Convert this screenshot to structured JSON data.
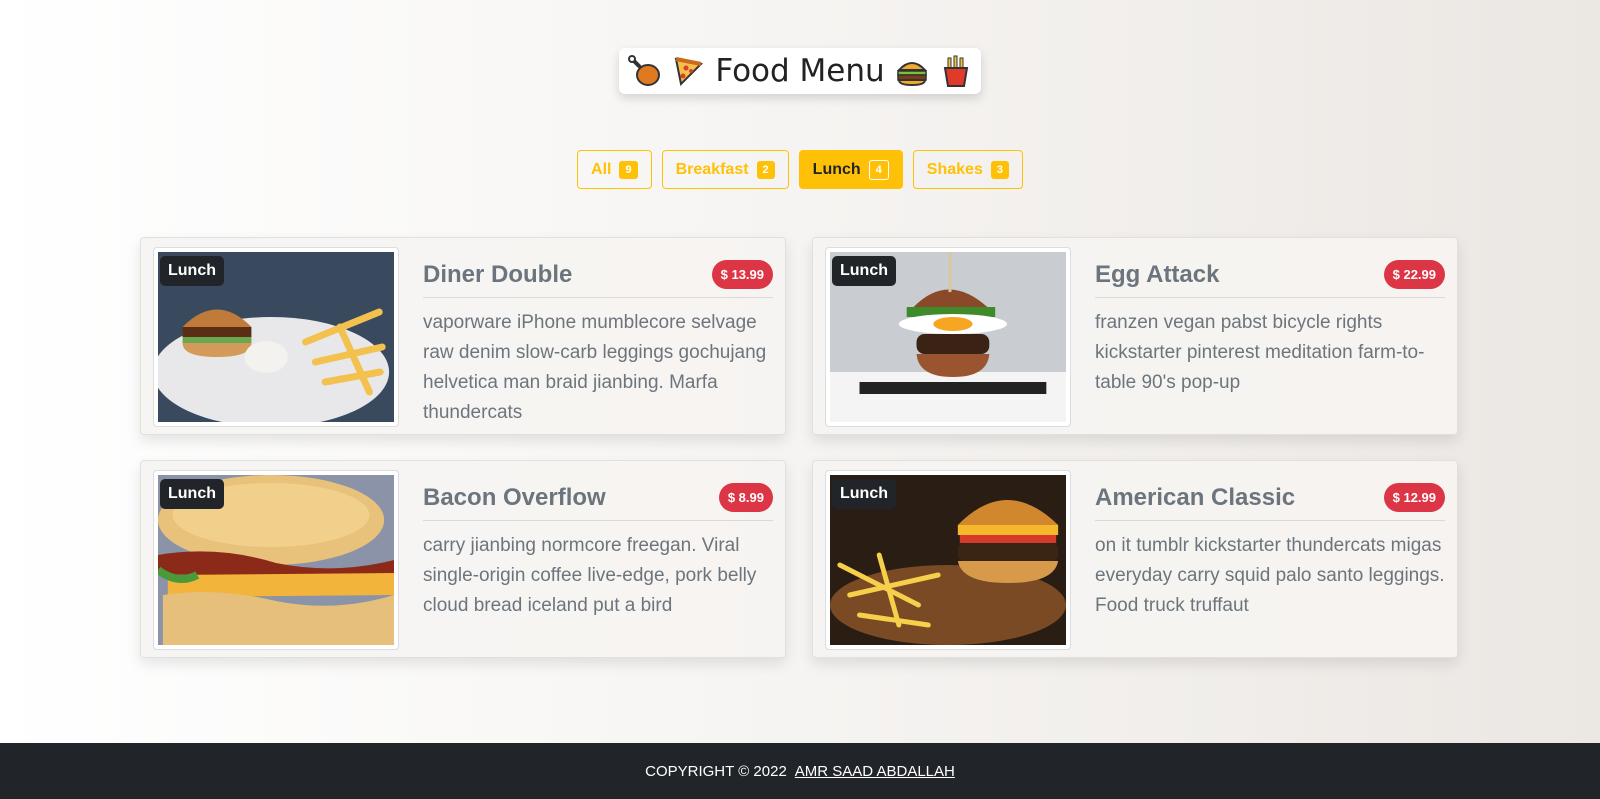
{
  "header": {
    "title": "Food Menu",
    "icons_left": [
      "chicken-leg-icon",
      "pizza-slice-icon"
    ],
    "icons_right": [
      "burger-icon",
      "fries-icon"
    ]
  },
  "filters": [
    {
      "label": "All",
      "count": "9",
      "active": false
    },
    {
      "label": "Breakfast",
      "count": "2",
      "active": false
    },
    {
      "label": "Lunch",
      "count": "4",
      "active": true
    },
    {
      "label": "Shakes",
      "count": "3",
      "active": false
    }
  ],
  "items": [
    {
      "category": "Lunch",
      "title": "Diner Double",
      "price": "$ 13.99",
      "desc": "vaporware iPhone mumblecore selvage raw denim slow-carb leggings gochujang helvetica man braid jianbing. Marfa thundercats",
      "image": "burger-fries-plate"
    },
    {
      "category": "Lunch",
      "title": "Egg Attack",
      "price": "$ 22.99",
      "desc": "franzen vegan pabst bicycle rights kickstarter pinterest meditation farm-to-table 90's pop-up",
      "image": "egg-burger"
    },
    {
      "category": "Lunch",
      "title": "Bacon Overflow",
      "price": "$ 8.99",
      "desc": "carry jianbing normcore freegan. Viral single-origin coffee live-edge, pork belly cloud bread iceland put a bird",
      "image": "bacon-biscuit"
    },
    {
      "category": "Lunch",
      "title": "American Classic",
      "price": "$ 12.99",
      "desc": "on it tumblr kickstarter thundercats migas everyday carry squid palo santo leggings. Food truck truffaut",
      "image": "burger-fries-board"
    }
  ],
  "footer": {
    "copyright": "COPYRIGHT © 2022",
    "author": "AMR SAAD ABDALLAH"
  },
  "colors": {
    "accent": "#ffc107",
    "price": "#dc3545",
    "dark": "#212529",
    "muted": "#6c757d"
  }
}
